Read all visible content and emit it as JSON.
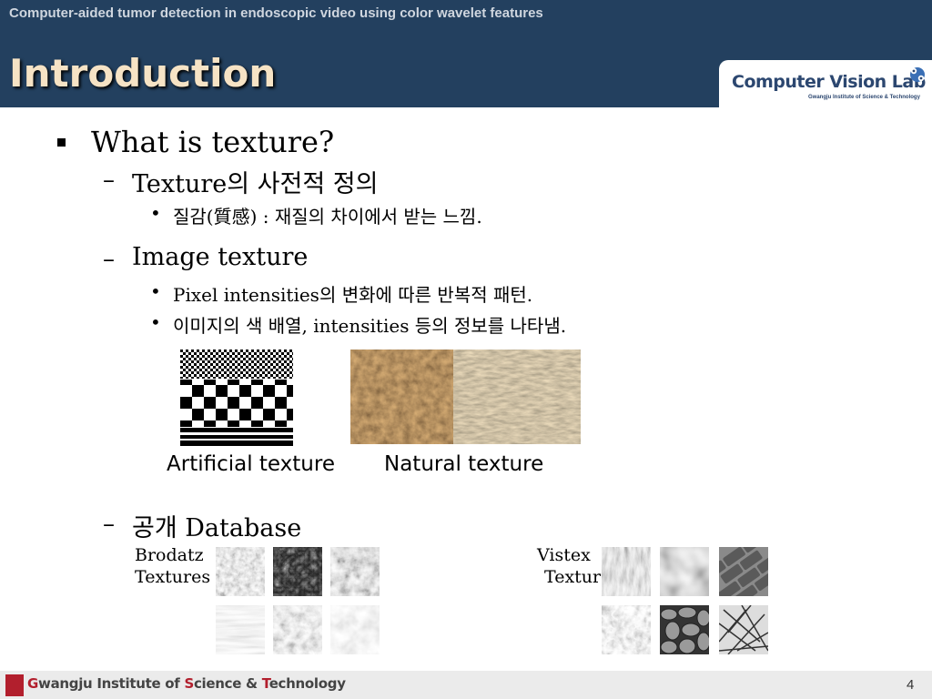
{
  "header": {
    "subtitle": "Computer-aided tumor detection in endoscopic video using color wavelet features",
    "title": "Introduction",
    "logo": {
      "text": "Computer Vision Lab",
      "sub": "Gwangju Institute of Science & Technology"
    }
  },
  "content": {
    "q": "What is texture?",
    "def_heading": "Texture의 사전적 정의",
    "def_item": "질감(質感) : 재질의 차이에서 받는 느낌.",
    "img_heading": "Image texture",
    "img_item1": "Pixel intensities의 변화에 따른 반복적 패턴.",
    "img_item2": "이미지의 색 배열, intensities 등의 정보를 나타냄.",
    "artificial_caption": "Artificial texture",
    "natural_caption": "Natural texture",
    "db_heading": "공개 Database",
    "brodatz_l1": "Brodatz",
    "brodatz_l2": "Textures",
    "vistex_l1": "Vistex",
    "vistex_l2": "Textur"
  },
  "footer": {
    "inst_G": "G",
    "inst_1": "wangju Institute of ",
    "inst_S": "S",
    "inst_2": "cience & ",
    "inst_T": "T",
    "inst_3": "echnology",
    "page": "4"
  },
  "colors": {
    "header_bg": "#23405f",
    "title": "#f6e3c5",
    "accent_red": "#b21f2d",
    "footer_bg": "#ebebeb"
  }
}
